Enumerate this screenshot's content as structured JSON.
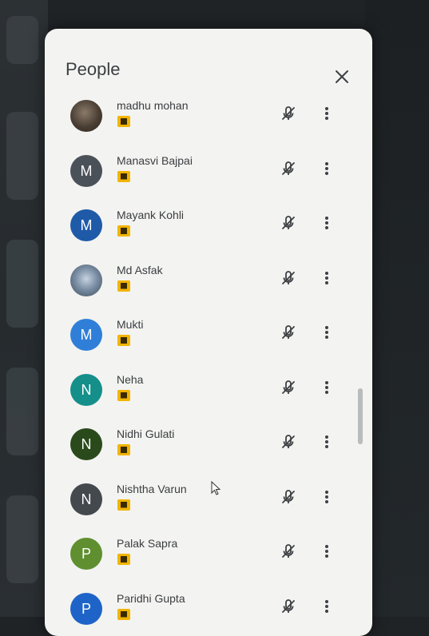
{
  "panel": {
    "title": "People"
  },
  "colors": {
    "panel_bg": "#f3f3f1",
    "badge": "#f1b400",
    "text": "#3a3d40"
  },
  "participants": [
    {
      "name": "madhu mohan",
      "avatar_type": "photo",
      "initial": "",
      "avatar_color": "#4a3e33"
    },
    {
      "name": "Manasvi Bajpai",
      "avatar_type": "initial",
      "initial": "M",
      "avatar_color": "#4a5159"
    },
    {
      "name": "Mayank Kohli",
      "avatar_type": "initial",
      "initial": "M",
      "avatar_color": "#1e5aa8"
    },
    {
      "name": "Md Asfak",
      "avatar_type": "photo",
      "initial": "",
      "avatar_color": "#7b8fa5"
    },
    {
      "name": "Mukti",
      "avatar_type": "initial",
      "initial": "M",
      "avatar_color": "#2f7fd8"
    },
    {
      "name": "Neha",
      "avatar_type": "initial",
      "initial": "N",
      "avatar_color": "#148f8a"
    },
    {
      "name": "Nidhi Gulati",
      "avatar_type": "initial",
      "initial": "N",
      "avatar_color": "#2b4a1c"
    },
    {
      "name": "Nishtha Varun",
      "avatar_type": "initial",
      "initial": "N",
      "avatar_color": "#44494e"
    },
    {
      "name": "Palak Sapra",
      "avatar_type": "initial",
      "initial": "P",
      "avatar_color": "#5f8f2f"
    },
    {
      "name": "Paridhi Gupta",
      "avatar_type": "initial",
      "initial": "P",
      "avatar_color": "#1e64c8"
    }
  ],
  "icons": {
    "close": "close-icon",
    "mic_off": "mic-off-icon",
    "more": "more-vert-icon",
    "role": "presenter-badge-icon"
  }
}
